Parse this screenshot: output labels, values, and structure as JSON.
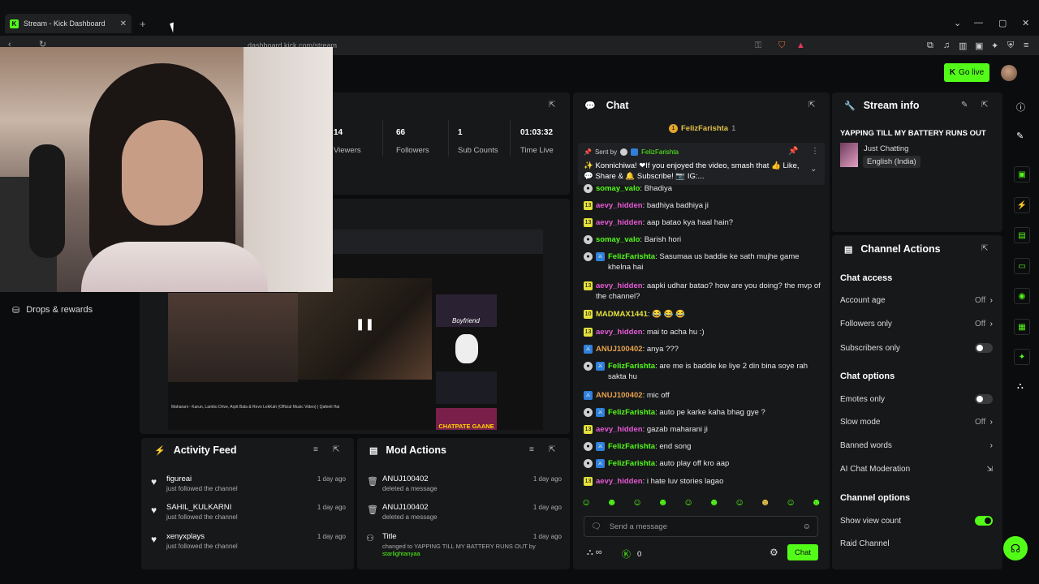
{
  "browser": {
    "tab_title": "Stream - Kick Dashboard",
    "url": "dashboard.kick.com/stream"
  },
  "header": {
    "go_live": "Go live"
  },
  "stats": [
    {
      "value": "14",
      "label": "Viewers"
    },
    {
      "value": "66",
      "label": "Followers"
    },
    {
      "value": "1",
      "label": "Sub Counts"
    },
    {
      "value": "01:03:32",
      "label": "Time Live"
    }
  ],
  "left_nav": {
    "drops": "Drops & rewards"
  },
  "chat": {
    "title": "Chat",
    "pinned_user": "FelizFarishta",
    "pinned_count": "1",
    "sent_by_label": "Sent by",
    "sent_by_user": "FelizFarishta",
    "pinned_text": "✨ Konnichiwa! ❤If you enjoyed the video, smash that 👍 Like, 💬 Share & 🔔 Subscribe! 📷 IG:...",
    "messages": [
      {
        "badge": "mod",
        "user": "somay_valo",
        "color": "#53fc18",
        "text": "Bhadiya"
      },
      {
        "badge": "13",
        "user": "aevy_hidden",
        "color": "#e55ad5",
        "text": "badhiya badhiya ji"
      },
      {
        "badge": "13",
        "user": "aevy_hidden",
        "color": "#e55ad5",
        "text": "aap batao kya haal hain?"
      },
      {
        "badge": "mod",
        "user": "somay_valo",
        "color": "#53fc18",
        "text": "Barish hori"
      },
      {
        "badge": "modvip",
        "user": "FelizFarishta",
        "color": "#53fc18",
        "text": "Sasumaa us baddie ke sath mujhe game khelna hai"
      },
      {
        "badge": "13",
        "user": "aevy_hidden",
        "color": "#e55ad5",
        "text": "aapki udhar batao? how are you doing? the mvp of the channel?"
      },
      {
        "badge": "10",
        "user": "MADMAX1441",
        "color": "#e3e03c",
        "text": "😂 😂 😂"
      },
      {
        "badge": "13",
        "user": "aevy_hidden",
        "color": "#e55ad5",
        "text": "mai to acha hu :)"
      },
      {
        "badge": "vip",
        "user": "ANUJ100402",
        "color": "#e7a24d",
        "text": "anya ???"
      },
      {
        "badge": "modvip",
        "user": "FelizFarishta",
        "color": "#53fc18",
        "text": "are me is baddie ke liye 2 din bina soye rah sakta hu"
      },
      {
        "badge": "vip",
        "user": "ANUJ100402",
        "color": "#e7a24d",
        "text": "mic off"
      },
      {
        "badge": "modvip",
        "user": "FelizFarishta",
        "color": "#53fc18",
        "text": "auto pe karke kaha bhag gye ?"
      },
      {
        "badge": "13",
        "user": "aevy_hidden",
        "color": "#e55ad5",
        "text": "gazab maharani ji"
      },
      {
        "badge": "modvip",
        "user": "FelizFarishta",
        "color": "#53fc18",
        "text": "end song"
      },
      {
        "badge": "modvip",
        "user": "FelizFarishta",
        "color": "#53fc18",
        "text": "auto play off kro aap"
      },
      {
        "badge": "13",
        "user": "aevy_hidden",
        "color": "#e55ad5",
        "text": "i hate luv stories lagao"
      }
    ],
    "input_placeholder": "Send a message",
    "count": "0",
    "send": "Chat"
  },
  "stream_info": {
    "title": "Stream info",
    "stream_title": "YAPPING TILL MY BATTERY RUNS OUT",
    "category": "Just Chatting",
    "language": "English (India)"
  },
  "channel_actions": {
    "title": "Channel Actions",
    "chat_access": "Chat access",
    "account_age": "Account age",
    "account_age_val": "Off",
    "followers_only": "Followers only",
    "followers_only_val": "Off",
    "subscribers_only": "Subscribers only",
    "chat_options": "Chat options",
    "emotes_only": "Emotes only",
    "slow_mode": "Slow mode",
    "slow_mode_val": "Off",
    "banned_words": "Banned words",
    "ai_mod": "AI Chat Moderation",
    "channel_options": "Channel options",
    "show_view_count": "Show view count",
    "raid_channel": "Raid Channel"
  },
  "activity": {
    "title": "Activity Feed",
    "items": [
      {
        "name": "figureai",
        "sub": "just followed the channel",
        "time": "1 day ago"
      },
      {
        "name": "SAHIL_KULKARNI",
        "sub": "just followed the channel",
        "time": "1 day ago"
      },
      {
        "name": "xenyxplays",
        "sub": "just followed the channel",
        "time": "1 day ago"
      }
    ]
  },
  "mod_actions": {
    "title": "Mod Actions",
    "items": [
      {
        "name": "ANUJ100402",
        "sub": "deleted a message",
        "time": "1 day ago"
      },
      {
        "name": "ANUJ100402",
        "sub": "deleted a message",
        "time": "1 day ago"
      },
      {
        "name": "Title",
        "sub": "changed to YAPPING TILL MY BATTERY RUNS OUT by",
        "by": "starlightanyaa",
        "time": "1 day ago"
      }
    ]
  },
  "preview": {
    "video_caption": "Maharani - Karun, Lambo Drive, Arpit Bala & Revo LekKah (Official Music Video) | Qafeeli Hai",
    "thumb1": "Boyfriend",
    "thumb2": "CHATPATE GAANE"
  }
}
